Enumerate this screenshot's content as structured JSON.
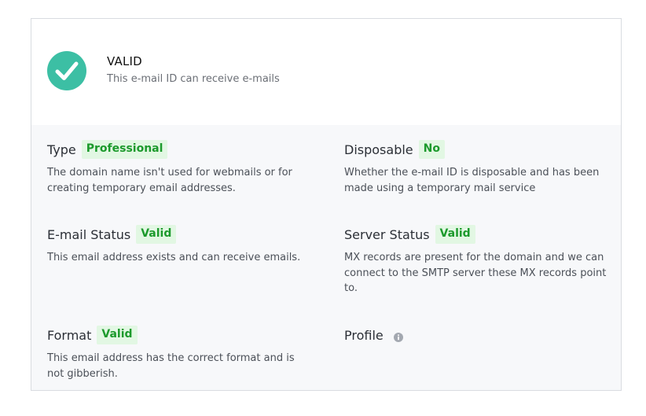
{
  "status": {
    "title": "VALID",
    "description": "This e-mail ID can receive e-mails",
    "icon": "check-circle-icon",
    "color": "#3cbfa4"
  },
  "details": {
    "type": {
      "label": "Type",
      "badge": "Professional",
      "description": "The domain name isn't used for webmails or for creating temporary email addresses."
    },
    "disposable": {
      "label": "Disposable",
      "badge": "No",
      "description": "Whether the e-mail ID is disposable and has been made using a temporary mail service"
    },
    "email_status": {
      "label": "E-mail Status",
      "badge": "Valid",
      "description": "This email address exists and can receive emails."
    },
    "server_status": {
      "label": "Server Status",
      "badge": "Valid",
      "description": "MX records are present for the domain and we can connect to the SMTP server these MX records point to."
    },
    "format": {
      "label": "Format",
      "badge": "Valid",
      "description": "This email address has the correct format and is not gibberish."
    },
    "profile": {
      "label": "Profile",
      "icon": "info-icon"
    }
  },
  "colors": {
    "badge_bg": "#e2f7e3",
    "badge_text": "#1c9a2c",
    "panel_bg": "#f7f8fa"
  }
}
